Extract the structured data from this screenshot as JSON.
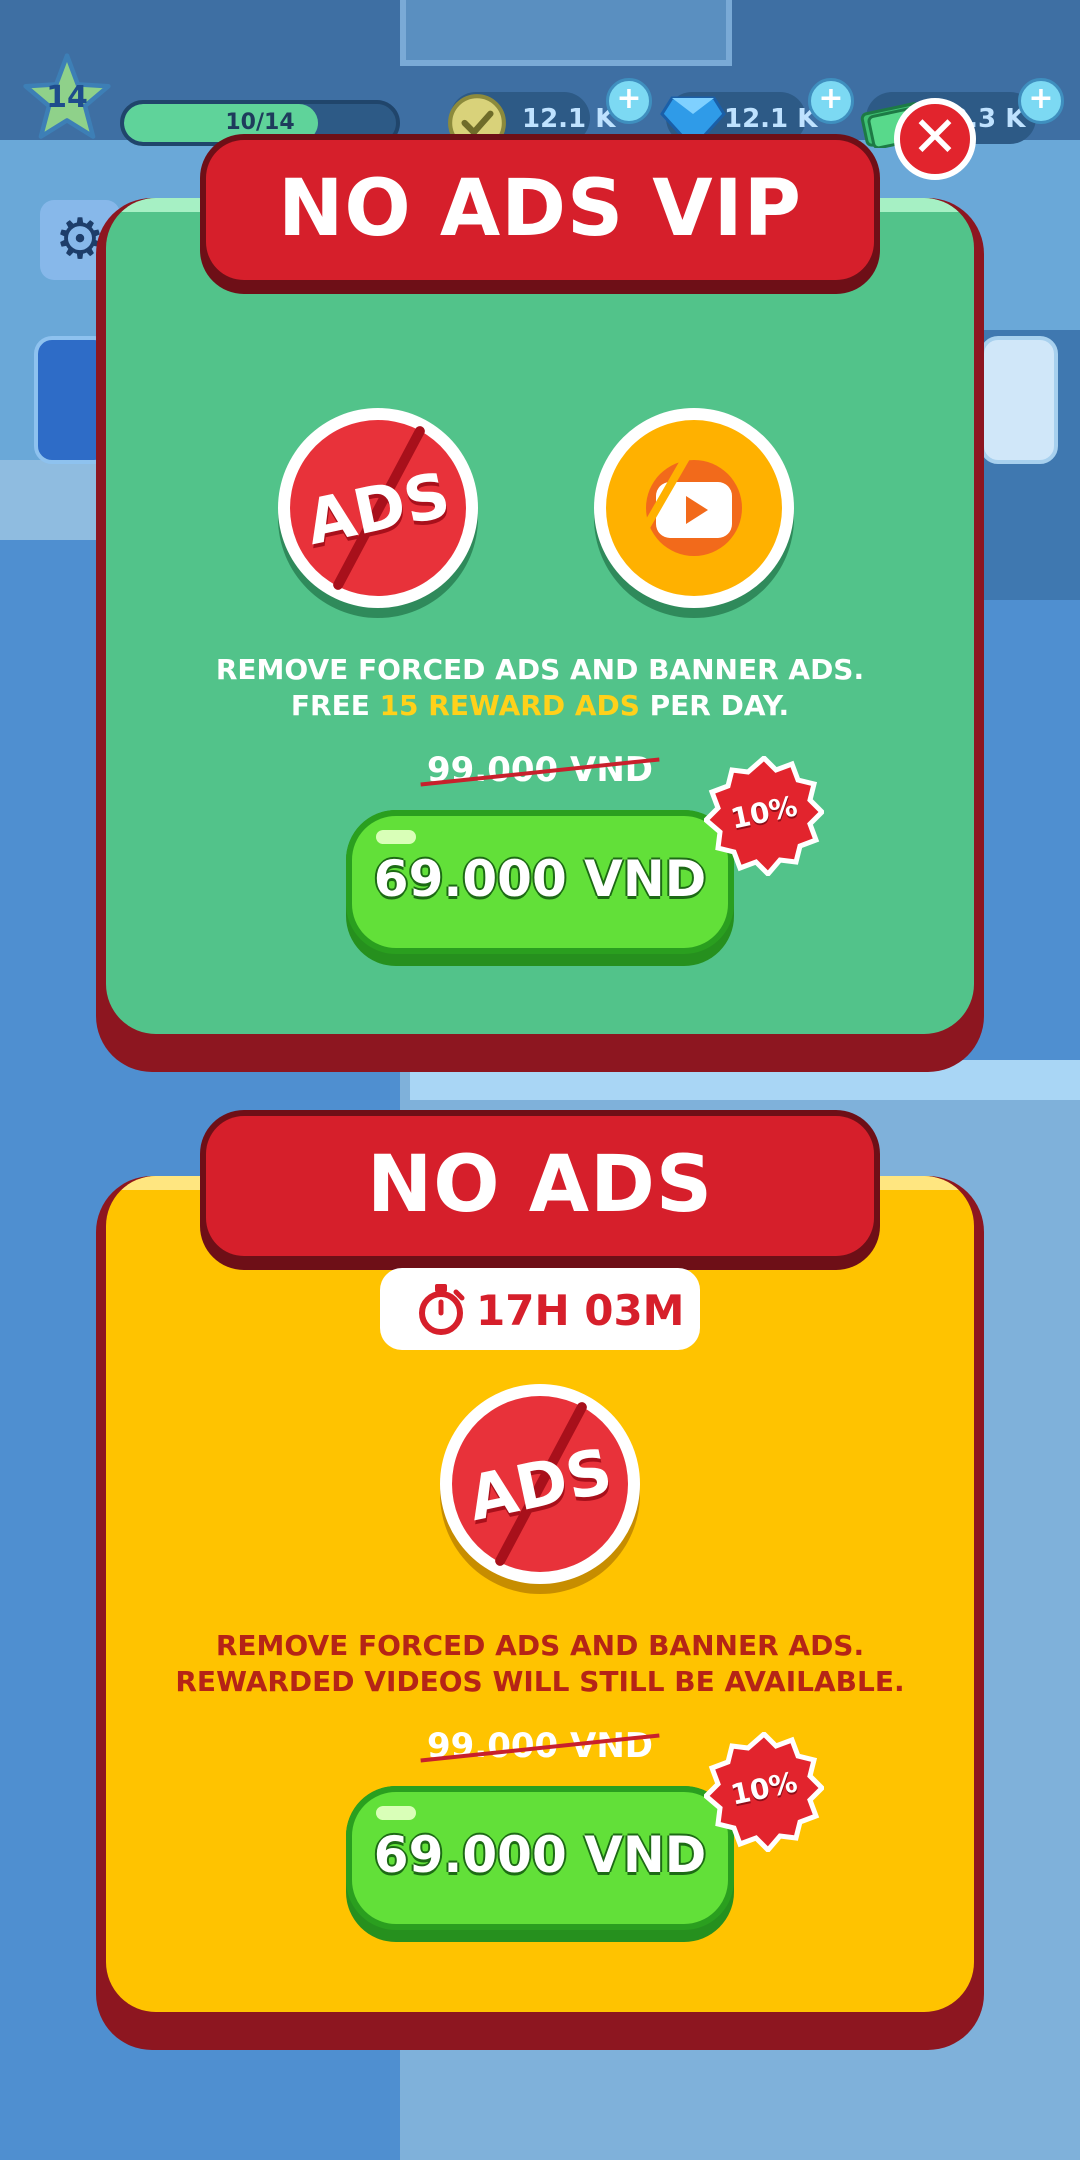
{
  "hud": {
    "level": "14",
    "xp_text": "10/14",
    "xp_progress": 0.714,
    "coins": "12.1 K",
    "gems": "12.1 K",
    "cash": "12.3 K"
  },
  "vip_offer": {
    "title": "NO ADS VIP",
    "desc_line1": "REMOVE FORCED ADS AND BANNER ADS.",
    "desc_line2_prefix": "FREE ",
    "desc_line2_highlight": "15 REWARD ADS",
    "desc_line2_suffix": " PER DAY.",
    "icon_text": "ADS",
    "old_price": "99.000 VND",
    "price": "69.000 VND",
    "discount": "10%"
  },
  "noads_offer": {
    "title": "NO ADS",
    "timer": "17H 03M",
    "desc_line1": "REMOVE FORCED ADS AND BANNER ADS.",
    "desc_line2": "REWARDED VIDEOS WILL STILL BE AVAILABLE.",
    "icon_text": "ADS",
    "old_price": "99.000 VND",
    "price": "69.000 VND",
    "discount": "10%"
  },
  "icons": {
    "close": "close-icon",
    "settings": "gear-icon",
    "level_star": "star-icon",
    "timer": "stopwatch-icon",
    "video_ads": "video-ads-icon"
  },
  "colors": {
    "vip_panel": "#52c38a",
    "noads_panel": "#ffc300",
    "ribbon": "#d61f2b",
    "buy_button": "#62e039"
  }
}
